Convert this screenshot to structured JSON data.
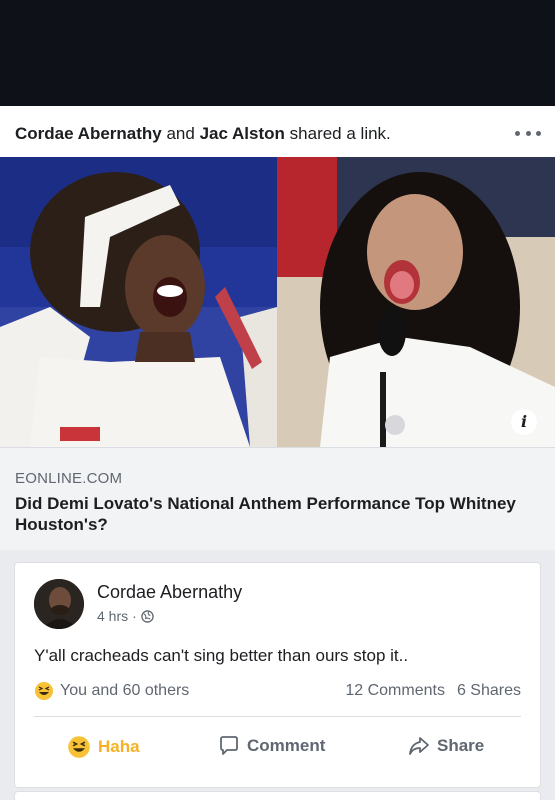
{
  "shared_post": {
    "actor_1": "Cordae Abernathy",
    "connector": "and",
    "actor_2": "Jac Alston",
    "action_text": "shared a link."
  },
  "link": {
    "domain": "EONLINE.COM",
    "title": "Did Demi Lovato's National Anthem Performance Top Whitney Houston's?"
  },
  "post": {
    "author": "Cordae Abernathy",
    "time": "4 hrs",
    "separator": "·",
    "text": "Y'all cracheads can't sing better than ours stop it..",
    "reactions_text": "You and 60 others",
    "comments_count": "12 Comments",
    "shares_count": "6 Shares"
  },
  "actions": {
    "haha": "Haha",
    "comment": "Comment",
    "share": "Share"
  },
  "icons": {
    "more": "more-horizontal-icon",
    "info": "info-icon",
    "globe": "globe-icon",
    "haha": "haha-emoji-icon",
    "comment": "comment-icon",
    "share": "share-arrow-icon"
  },
  "colors": {
    "top_bar": "#0e1117",
    "haha_accent": "#f7b125",
    "secondary_text": "#606770",
    "page_background": "#e9ebee"
  }
}
